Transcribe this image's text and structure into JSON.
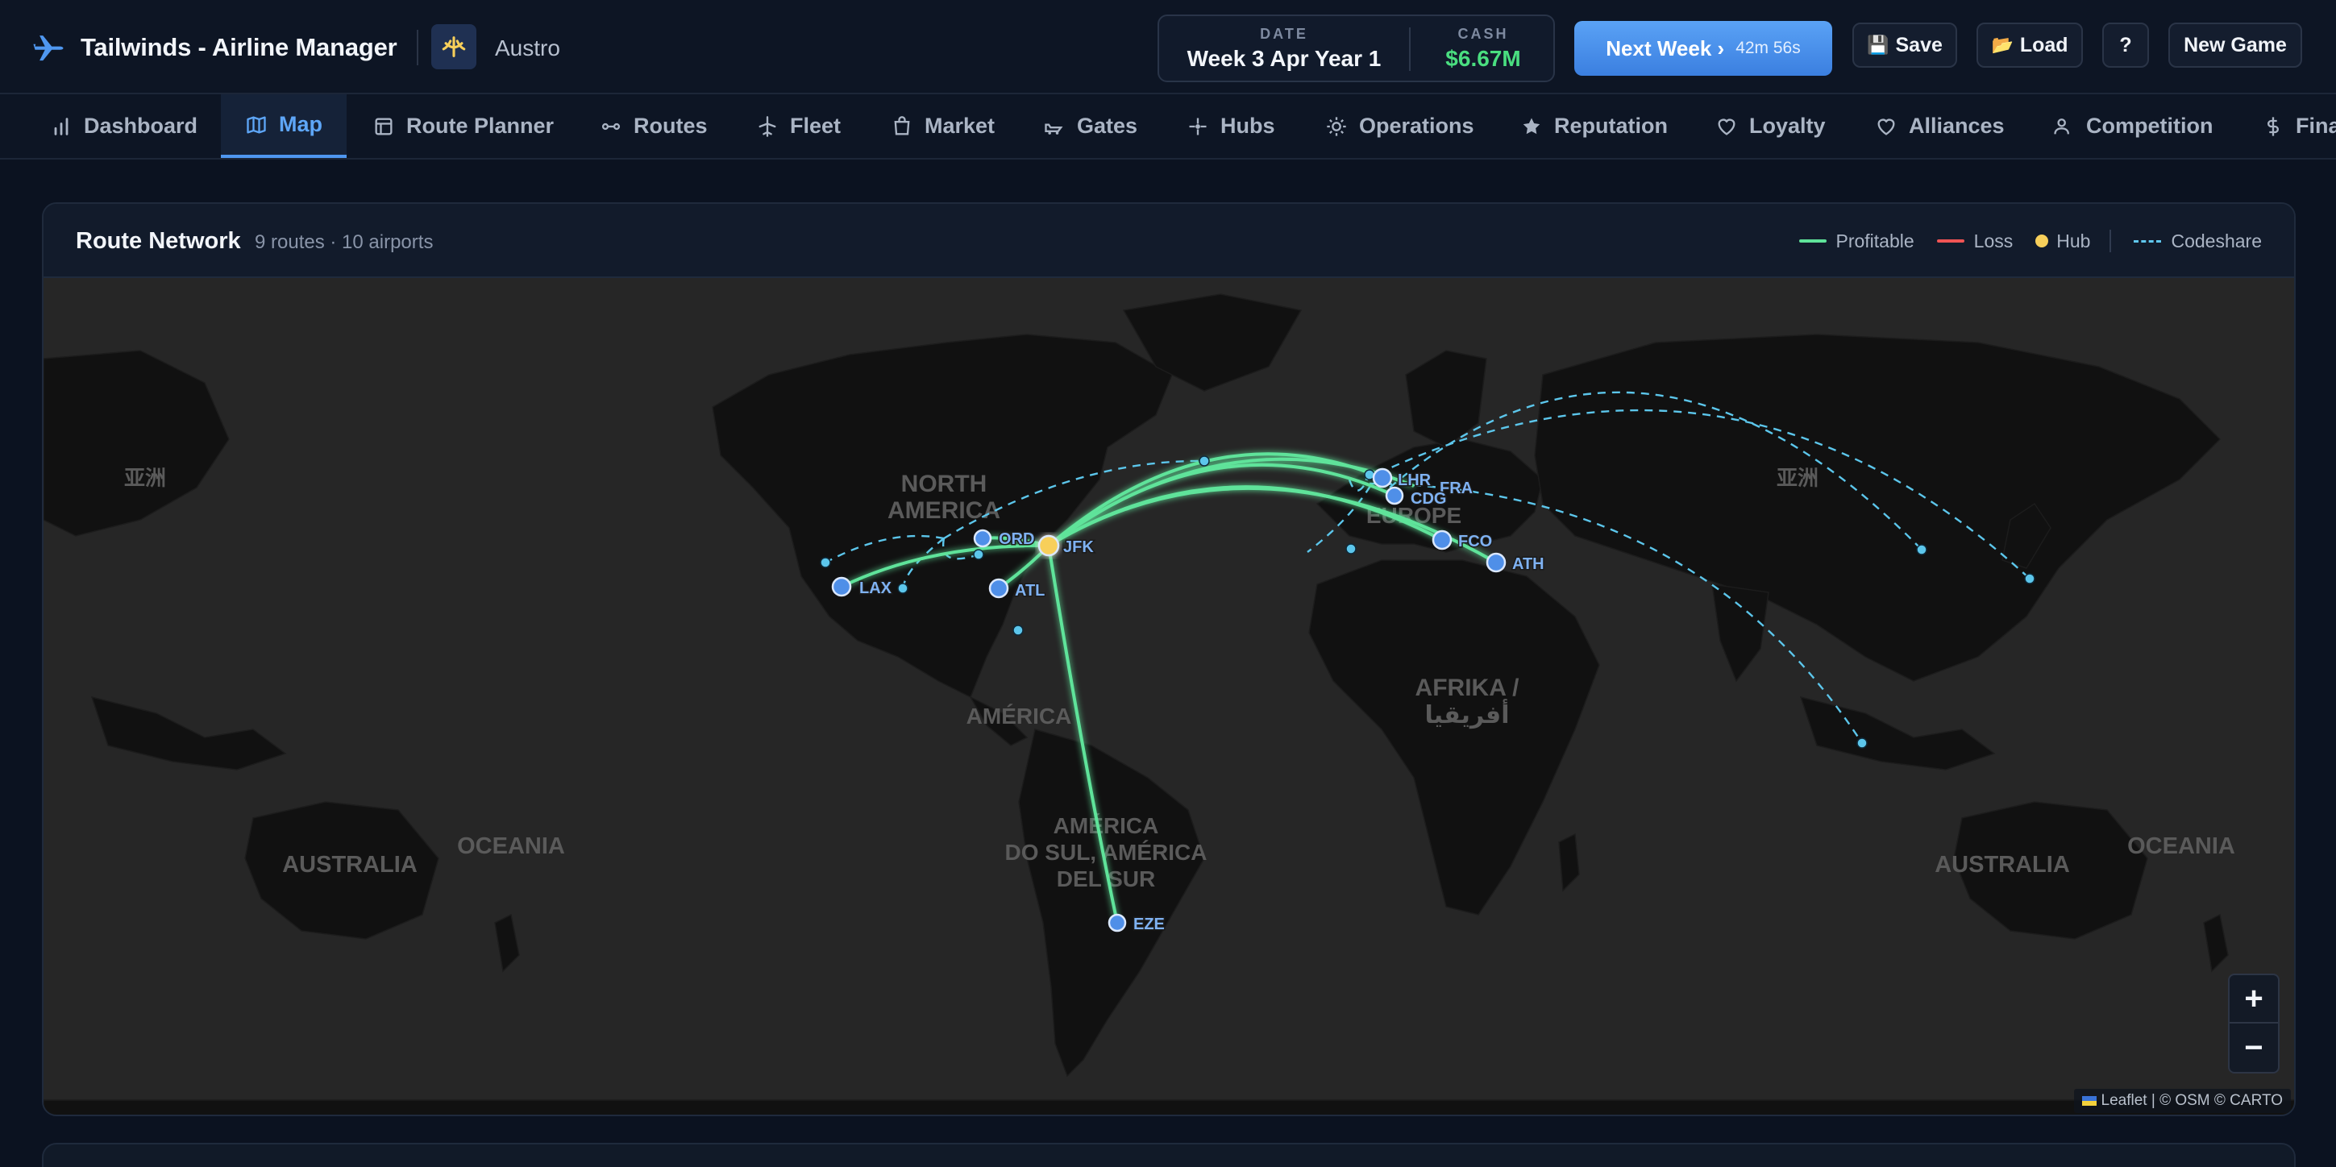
{
  "app": {
    "title": "Tailwinds - Airline Manager",
    "airline_name": "Austro",
    "date_label": "DATE",
    "date_value": "Week 3 Apr Year 1",
    "cash_label": "CASH",
    "cash_value": "$6.67M",
    "next_week_label": "Next Week ›",
    "next_week_timer": "42m 56s",
    "save_label": "Save",
    "load_label": "Load",
    "help_label": "?",
    "new_game_label": "New Game"
  },
  "nav": {
    "items": [
      {
        "label": "Dashboard",
        "icon": "bar-chart-icon"
      },
      {
        "label": "Map",
        "icon": "map-icon",
        "active": true
      },
      {
        "label": "Route Planner",
        "icon": "layout-icon"
      },
      {
        "label": "Routes",
        "icon": "route-icon"
      },
      {
        "label": "Fleet",
        "icon": "plane-icon"
      },
      {
        "label": "Market",
        "icon": "shopping-bag-icon"
      },
      {
        "label": "Gates",
        "icon": "gate-icon"
      },
      {
        "label": "Hubs",
        "icon": "hub-icon"
      },
      {
        "label": "Operations",
        "icon": "sun-cog-icon"
      },
      {
        "label": "Reputation",
        "icon": "star-icon"
      },
      {
        "label": "Loyalty",
        "icon": "heart-icon"
      },
      {
        "label": "Alliances",
        "icon": "heart-icon"
      },
      {
        "label": "Competition",
        "icon": "users-icon"
      },
      {
        "label": "Fina",
        "icon": "dollar-icon"
      }
    ]
  },
  "map_panel": {
    "title": "Route Network",
    "subtitle": "9 routes · 10 airports",
    "legend": {
      "profitable": "Profitable",
      "loss": "Loss",
      "hub": "Hub",
      "codeshare": "Codeshare"
    },
    "zoom_in": "+",
    "zoom_out": "−",
    "attribution": "Leaflet | © OSM © CARTO",
    "region_labels": [
      "NORTH",
      "AMERICA",
      "AMÉRICA",
      "AMÉRICA",
      "DO SUL, AMÉRICA",
      "DEL SUR",
      "EUROPE",
      "AFRIKA /",
      "أفريقيا",
      "亚洲",
      "亚洲",
      "AUSTRALIA",
      "AUSTRALIA",
      "OCEANIA",
      "OCEANIA"
    ],
    "airports": [
      "JFK",
      "ORD",
      "LAX",
      "ATL",
      "EZE",
      "LHR",
      "FRA",
      "CDG",
      "FCO",
      "ATH"
    ],
    "hub": "JFK"
  },
  "colors": {
    "profitable": "#5fe39a",
    "loss": "#f05454",
    "hub": "#f7cf5a",
    "codeshare": "#5cc6eb",
    "accent": "#4f97f0",
    "cash": "#4ade80"
  }
}
